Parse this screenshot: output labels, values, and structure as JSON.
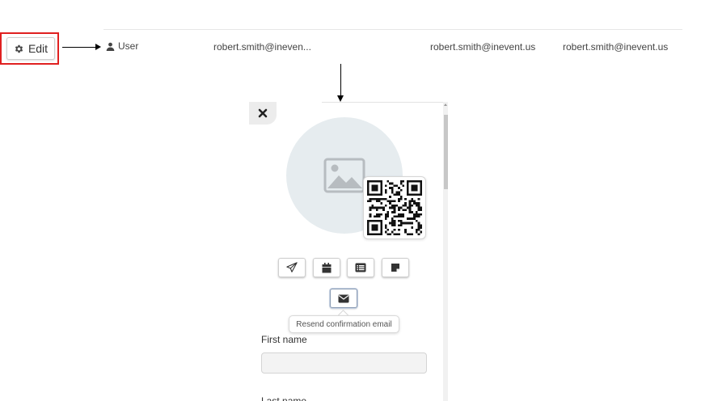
{
  "toolbar": {
    "edit_label": "Edit"
  },
  "table_row": {
    "role_label": "User",
    "name_value": "robert.smith@ineven...",
    "email_value": "robert.smith@inevent.us",
    "username_value": "robert.smith@inevent.us"
  },
  "modal": {
    "tooltip": "Resend confirmation email",
    "first_name_label": "First name",
    "first_name_value": "",
    "last_name_label": "Last name"
  },
  "colors": {
    "highlight_red": "#e02020",
    "avatar_bg": "#e6ecef"
  },
  "icons": [
    "gear-icon",
    "user-icon",
    "close-icon",
    "image-placeholder-icon",
    "qr-code-icon",
    "send-icon",
    "calendar-icon",
    "list-icon",
    "note-icon",
    "envelope-icon"
  ]
}
